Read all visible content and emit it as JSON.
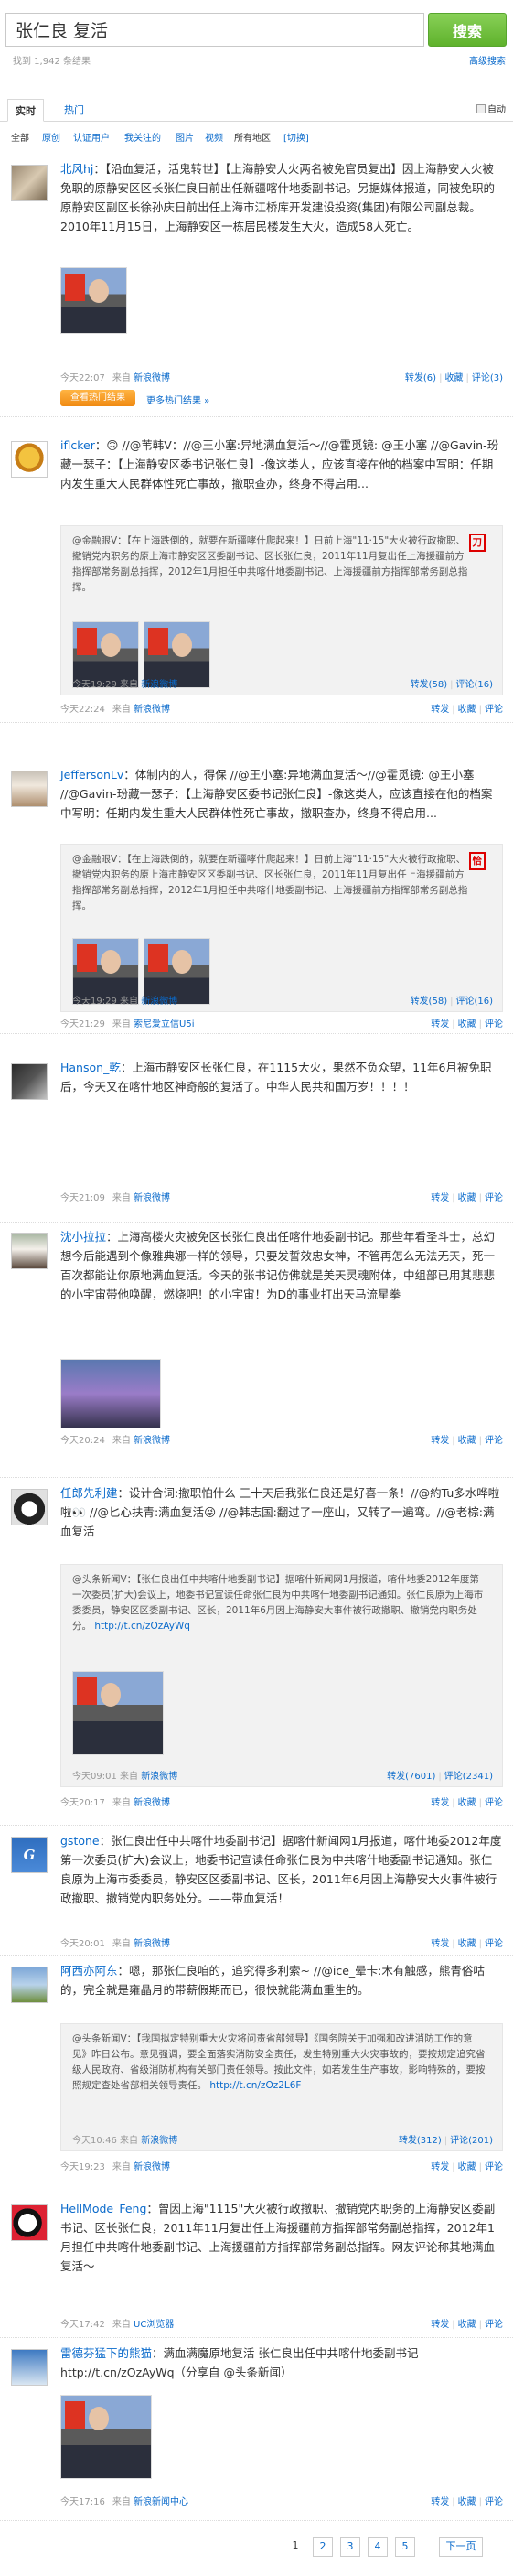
{
  "search": {
    "query": "张仁良 复活",
    "button": "搜索",
    "count": "找到 1,942 条结果",
    "advanced": "高级搜索"
  },
  "tabs": {
    "realtime": "实时",
    "hot": "热门",
    "refresh": "自动"
  },
  "filters": [
    "全部",
    "原创",
    "认证用户",
    "我关注的",
    "图片",
    "视频",
    "所有地区",
    "[切换]"
  ],
  "posts": [
    {
      "user": "北风hj",
      "text": "：【沿血复活，活鬼转世】【上海静安大火两名被免官员复出】因上海静安大火被免职的原静安区区长张仁良日前出任新疆喀什地委副书记。另据媒体报道，同被免职的原静安区副区长徐孙庆日前出任上海市江桥库开发建设投资(集团)有限公司副总裁。2010年11月15日，上海静安区一栋居民楼发生大火，造成58人死亡。",
      "time": "今天22:07",
      "src_label": "来自",
      "src": "新浪微博",
      "fwd": "转发(6)",
      "fav": "收藏",
      "cmt": "评论(3)"
    },
    {
      "user": "iflcker",
      "text": "：🙃 //@苇韩V：//@王小塞:异地满血复活～//@霍觅镜: @王小塞 //@Gavin-玢藏一瑟子：【上海静安区委书记张仁良】-像这类人，应该直接在他的档案中写明：任期内发生重大人民群体性死亡事故，撤职查办，终身不得启用...",
      "repost": "@金融眼V：【在上海跌倒的，就要在新疆哮什爬起来！】日前上海\"11·15\"大火被行政撤职、撤销党内职务的原上海市静安区区委副书记、区长张仁良，2011年11月复出任上海援疆前方指挥部常务副总指挥，2012年1月担任中共喀什地委副书记、上海援疆前方指挥部常务副总指挥。",
      "stamp": "刀",
      "rtime": "今天19:29",
      "rsrc": "新浪微博",
      "rfwd": "转发(58)",
      "rcmt": "评论(16)",
      "time": "今天22:24",
      "src_label": "来自",
      "src": "新浪微博",
      "fwd": "转发",
      "fav": "收藏",
      "cmt": "评论"
    },
    {
      "user": "JeffersonLv",
      "text": "：体制内的人，得保 //@王小塞:异地满血复活～//@霍觅镜: @王小塞 //@Gavin-玢藏一瑟子：【上海静安区委书记张仁良】-像这类人，应该直接在他的档案中写明：任期内发生重大人民群体性死亡事故，撤职查办，终身不得启用...",
      "repost": "@金融眼V：【在上海跌倒的，就要在新疆哮什爬起来！】日前上海\"11·15\"大火被行政撤职、撤销党内职务的原上海市静安区区委副书记、区长张仁良，2011年11月复出任上海援疆前方指挥部常务副总指挥，2012年1月担任中共喀什地委副书记、上海援疆前方指挥部常务副总指挥。",
      "stamp": "恰",
      "rtime": "今天19:29",
      "rsrc": "新浪微博",
      "rfwd": "转发(58)",
      "rcmt": "评论(16)",
      "time": "今天21:29",
      "src_label": "来自",
      "src": "索尼爱立信U5i",
      "fwd": "转发",
      "fav": "收藏",
      "cmt": "评论"
    },
    {
      "user": "Hanson_乾",
      "text": "：上海市静安区长张仁良，在1115大火，果然不负众望，11年6月被免职后，今天又在喀什地区神奇般的复活了。中华人民共和国万岁！！！！",
      "time": "今天21:09",
      "src_label": "来自",
      "src": "新浪微博",
      "fwd": "转发",
      "fav": "收藏",
      "cmt": "评论"
    },
    {
      "user": "沈小拉拉",
      "text": "：上海高楼火灾被免区长张仁良出任喀什地委副书记。那些年看圣斗士，总幻想今后能遇到个像雅典娜一样的领导，只要发誓效忠女神，不管再怎么无法无天，死一百次都能让你原地满血复活。今天的张书记仿佛就是美天灵魂附体，中组部已用其悲悲的小宇宙带他唤醒，燃烧吧！的小宇宙！为D的事业打出天马流星拳",
      "time": "今天20:24",
      "src_label": "来自",
      "src": "新浪微博",
      "fwd": "转发",
      "fav": "收藏",
      "cmt": "评论"
    },
    {
      "user": "任郎先利建",
      "text": "：设计合词:撤职怕什么 三十天后我张仁良还是好喜一条！//@約Tu多水哗啦啦👀 //@匕心扶青:满血复活😝 //@韩志国:翻过了一座山，又转了一遍弯。//@老棕:满血复活",
      "repost": "@头条新闻V：【张仁良出任中共喀什地委副书记】据喀什新闻网1月报道，喀什地委2012年度第一次委员(扩大)会议上，地委书记宣读任命张仁良为中共喀什地委副书记通知。张仁良原为上海市委委员，静安区区委副书记、区长，2011年6月因上海静安大事件被行政撤职、撤销党内职务处分。",
      "rlink": "http://t.cn/zOzAyWq",
      "rtime": "今天09:01",
      "rsrc": "新浪微博",
      "rfwd": "转发(7601)",
      "rcmt": "评论(2341)",
      "time": "今天20:17",
      "src_label": "来自",
      "src": "新浪微博",
      "fwd": "转发",
      "fav": "收藏",
      "cmt": "评论"
    },
    {
      "user": "gstone",
      "text": "：张仁良出任中共喀什地委副书记】据喀什新闻网1月报道，喀什地委2012年度第一次委员(扩大)会议上，地委书记宣读任命张仁良为中共喀什地委副书记通知。张仁良原为上海市委委员，静安区区委副书记、区长，2011年6月因上海静安大火事件被行政撤职、撤销党内职务处分。——带血复活！",
      "time": "今天20:01",
      "src_label": "来自",
      "src": "新浪微博",
      "fwd": "转发",
      "fav": "收藏",
      "cmt": "评论"
    },
    {
      "user": "阿西亦阿东",
      "text": "：嗯，那张仁良咱的，追究得多利索~ //@ice_晕卡:木有触感，熊青俗咕的，完全就是雍晶月的带薪假期而已，很快就能满血重生的。",
      "repost": "@头条新闻V：【我国拟定特别重大火灾将问责省部领导】《国务院关于加强和改进消防工作的意见》昨日公布。意见强调，要全面落实消防安全责任，发生特别重大火灾事故的，要按规定追究省级人民政府、省级消防机构有关部门责任领导。按此文件，如若发生生产事故，影响特殊的，要按照规定查处省部相关领导责任。",
      "rlink": "http://t.cn/zOz2L6F",
      "rtime": "今天10:46",
      "rsrc": "新浪微博",
      "rfwd": "转发(312)",
      "rcmt": "评论(201)",
      "time": "今天19:23",
      "src_label": "来自",
      "src": "新浪微博",
      "fwd": "转发",
      "fav": "收藏",
      "cmt": "评论"
    },
    {
      "user": "HellMode_Feng",
      "text": "：曾因上海\"1115\"大火被行政撤职、撤销党内职务的上海静安区委副书记、区长张仁良，2011年11月复出任上海援疆前方指挥部常务副总指挥，2012年1月担任中共喀什地委副书记、上海援疆前方指挥部常务副总指挥。网友评论称其地满血复活～",
      "time": "今天17:42",
      "src_label": "来自",
      "src": "UC浏览器",
      "fwd": "转发",
      "fav": "收藏",
      "cmt": "评论"
    },
    {
      "user": "雷德芬猛下的熊猫",
      "text": "：满血满魔原地复活 张仁良出任中共喀什地委副书记 http://t.cn/zOzAyWq（分享自 @头条新闻）",
      "time": "今天17:16",
      "src_label": "来自",
      "src": "新浪新闻中心",
      "fwd": "转发",
      "fav": "收藏",
      "cmt": "评论"
    }
  ],
  "hot": {
    "button": "查看热门结果",
    "more": "更多热门结果 »"
  },
  "pager": [
    "1",
    "2",
    "3",
    "4",
    "5",
    "下一页"
  ]
}
